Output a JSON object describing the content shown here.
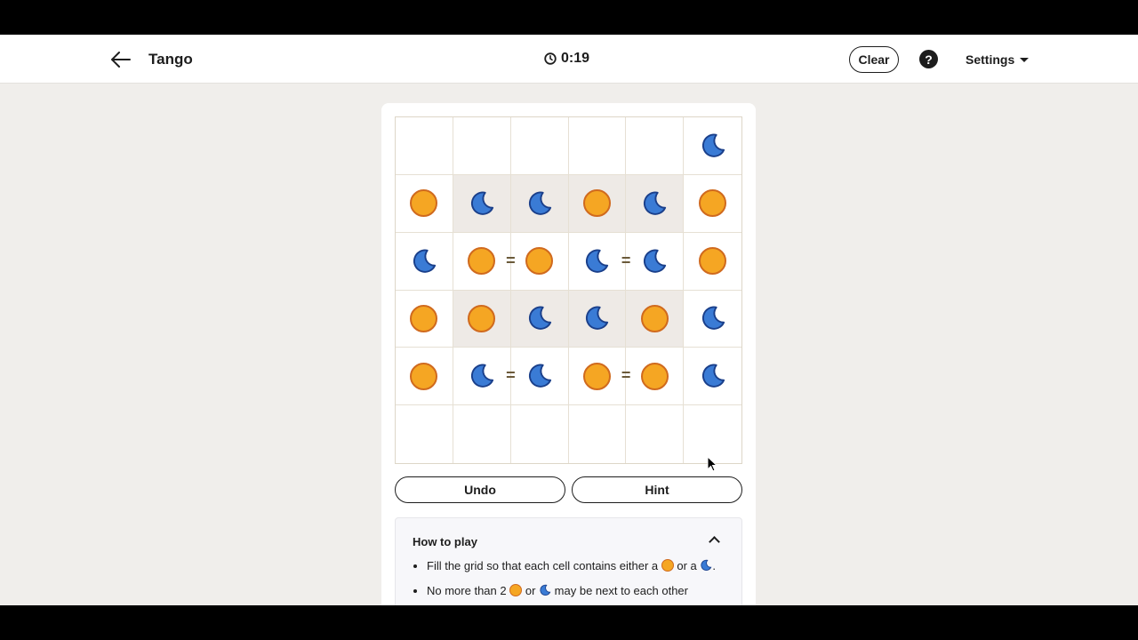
{
  "header": {
    "title": "Tango",
    "timer": "0:19",
    "clear_label": "Clear",
    "help_label": "?",
    "settings_label": "Settings"
  },
  "board": {
    "cells": [
      [
        "",
        "",
        "",
        "",
        "",
        "moon"
      ],
      [
        "sun",
        "moon",
        "moon",
        "sun",
        "moon",
        "sun"
      ],
      [
        "moon",
        "sun",
        "sun",
        "moon",
        "moon",
        "sun"
      ],
      [
        "sun",
        "sun",
        "moon",
        "moon",
        "sun",
        "moon"
      ],
      [
        "sun",
        "moon",
        "moon",
        "sun",
        "sun",
        "moon"
      ],
      [
        "",
        "",
        "",
        "",
        "",
        ""
      ]
    ],
    "locked": [
      [
        false,
        false,
        false,
        false,
        false,
        false
      ],
      [
        false,
        true,
        true,
        true,
        true,
        false
      ],
      [
        false,
        false,
        false,
        false,
        false,
        false
      ],
      [
        false,
        true,
        true,
        true,
        true,
        false
      ],
      [
        false,
        false,
        false,
        false,
        false,
        false
      ],
      [
        false,
        false,
        false,
        false,
        false,
        false
      ]
    ],
    "equals_constraints": [
      {
        "row": 2,
        "between_cols": [
          1,
          2
        ]
      },
      {
        "row": 2,
        "between_cols": [
          3,
          4
        ]
      },
      {
        "row": 4,
        "between_cols": [
          1,
          2
        ]
      },
      {
        "row": 4,
        "between_cols": [
          3,
          4
        ]
      }
    ],
    "equals_symbol": "="
  },
  "actions": {
    "undo_label": "Undo",
    "hint_label": "Hint"
  },
  "how_to_play": {
    "title": "How to play",
    "rule1_prefix": "Fill the grid so that each cell contains either a",
    "rule1_mid": "or a",
    "rule1_suffix": ".",
    "rule2_prefix": "No more than 2",
    "rule2_mid": "or",
    "rule2_suffix": "may be next to each other"
  },
  "colors": {
    "sun_fill": "#f5a623",
    "sun_stroke": "#d06a1e",
    "moon_fill": "#3a7bd5",
    "moon_stroke": "#1a3f8a",
    "locked_cell": "#eeeae6",
    "background": "#f0eeeb"
  },
  "icons": {
    "back": "arrow-left-icon",
    "timer": "clock-icon",
    "help": "question-circle-icon",
    "settings": "caret-down-icon",
    "collapse": "chevron-up-icon",
    "sun": "sun-icon",
    "moon": "moon-icon"
  }
}
